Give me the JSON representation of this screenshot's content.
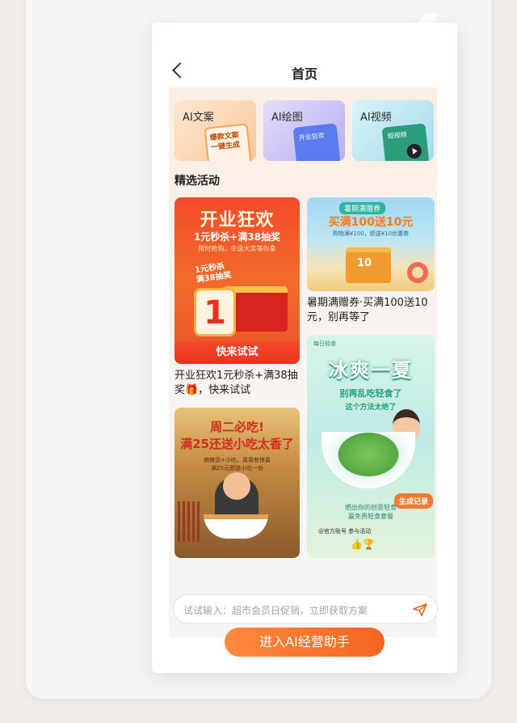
{
  "nav": {
    "title": "首页"
  },
  "tools": [
    {
      "label": "AI文案",
      "thumb_text": "爆款文案\n一键生成"
    },
    {
      "label": "AI绘图",
      "thumb_text": "开业狂欢"
    },
    {
      "label": "AI视频",
      "thumb_text": "短视频"
    }
  ],
  "section_title": "精选活动",
  "posts": {
    "opening": {
      "headline": "开业狂欢",
      "sub": "1元秒杀+满38抽奖",
      "sub2": "限时抢购，幸运大奖等你拿",
      "badge": "1元秒杀\n满38抽奖",
      "price": "1",
      "button": "快来试试",
      "caption": "开业狂欢1元秒杀+满38抽奖🎁，快来试试"
    },
    "summer": {
      "tag": "暑期满赠券",
      "headline": "买满100送10元",
      "sub": "购物满¥100，即送¥10优惠券",
      "box_text": "10",
      "caption": "暑期满赠券·买满100送10元，别再等了"
    },
    "ice": {
      "brand": "每日轻食",
      "headline": "冰爽一夏",
      "sub": "别再乱吃轻食了",
      "sub2": "这个方法太绝了",
      "record": "生成记录",
      "invite": "晒出你的创意轻食\n赢免费轻食套餐",
      "foot": "@官方账号  参与活动",
      "icons": "👍🏆"
    },
    "tuesday": {
      "headline": "周二必吃!\n满25还送小吃太香了",
      "sub": "麻辣烫+小吃，周周有惊喜\n满25元即送小吃一份"
    }
  },
  "input": {
    "placeholder": "试试输入：超市会员日促销，立即获取方案"
  },
  "cta": "进入AI经营助手",
  "colors": {
    "accent": "#f46420",
    "brand_red": "#e9341f"
  }
}
